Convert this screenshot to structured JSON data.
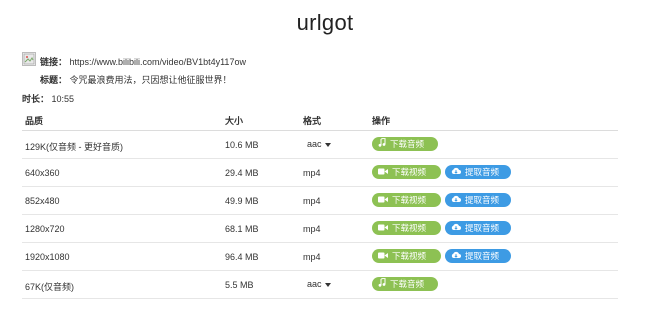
{
  "app": {
    "title": "urlgot"
  },
  "info": {
    "link_label": "链接：",
    "link_value": "https://www.bilibili.com/video/BV1bt4y117ow",
    "title_label": "标题：",
    "title_value": "令咒最浪费用法，只因想让他征服世界！",
    "duration_label": "时长：",
    "duration_value": "10:55"
  },
  "table": {
    "headers": {
      "quality": "品质",
      "size": "大小",
      "format": "格式",
      "actions": "操作"
    },
    "rows": [
      {
        "quality": "129K(仅音频 - 更好音质)",
        "size": "10.6 MB",
        "format": "aac",
        "format_select": true,
        "buttons": [
          "下载音频"
        ]
      },
      {
        "quality": "640x360",
        "size": "29.4 MB",
        "format": "mp4",
        "format_select": false,
        "buttons": [
          "下载视频",
          "提取音频"
        ]
      },
      {
        "quality": "852x480",
        "size": "49.9 MB",
        "format": "mp4",
        "format_select": false,
        "buttons": [
          "下载视频",
          "提取音频"
        ]
      },
      {
        "quality": "1280x720",
        "size": "68.1 MB",
        "format": "mp4",
        "format_select": false,
        "buttons": [
          "下载视频",
          "提取音频"
        ]
      },
      {
        "quality": "1920x1080",
        "size": "96.4 MB",
        "format": "mp4",
        "format_select": false,
        "buttons": [
          "下载视频",
          "提取音频"
        ]
      },
      {
        "quality": "67K(仅音频)",
        "size": "5.5 MB",
        "format": "aac",
        "format_select": true,
        "buttons": [
          "下载音频"
        ]
      }
    ]
  },
  "icons": {
    "thumbnail": "broken-image-icon",
    "music": "music-note-icon",
    "video": "video-camera-icon",
    "cloud": "cloud-download-icon",
    "caret": "caret-down-icon"
  },
  "colors": {
    "green_button": "#8dc153",
    "blue_button": "#3d9be4"
  }
}
